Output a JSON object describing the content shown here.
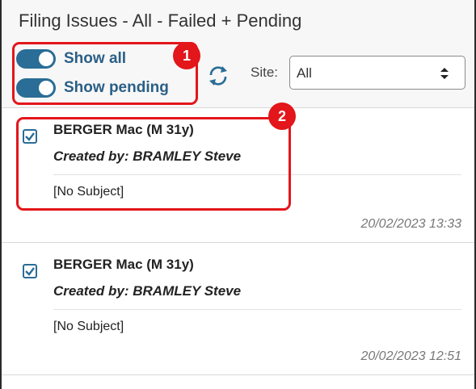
{
  "header": {
    "title": "Filing Issues - All - Failed + Pending",
    "toggles": [
      {
        "label": "Show all",
        "on": true
      },
      {
        "label": "Show pending",
        "on": true
      }
    ],
    "site_label": "Site:",
    "site_value": "All"
  },
  "items": [
    {
      "patient": "BERGER Mac (M 31y)",
      "created_by": "Created by: BRAMLEY Steve",
      "subject": "[No Subject]",
      "timestamp": "20/02/2023 13:33",
      "checked": true
    },
    {
      "patient": "BERGER Mac (M 31y)",
      "created_by": "Created by: BRAMLEY Steve",
      "subject": "[No Subject]",
      "timestamp": "20/02/2023 12:51",
      "checked": true
    }
  ],
  "annotations": [
    {
      "number": "1"
    },
    {
      "number": "2"
    }
  ],
  "colors": {
    "accent": "#2a6d96",
    "annotation": "#e3161b"
  },
  "icons": {
    "refresh": "refresh-icon",
    "select_caret": "sort-caret-icon",
    "checkbox": "checkbox-checked-icon"
  }
}
